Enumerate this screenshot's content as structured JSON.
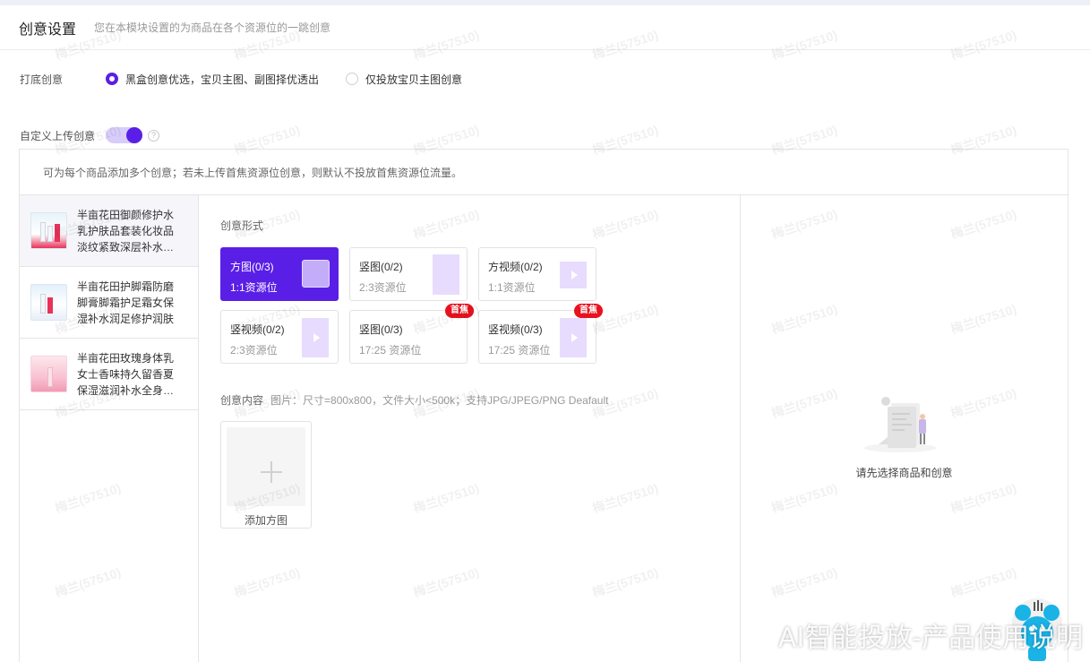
{
  "header": {
    "title": "创意设置",
    "desc": "您在本模块设置的为商品在各个资源位的一跳创意"
  },
  "fallback": {
    "label": "打底创意",
    "options": [
      {
        "label": "黑盒创意优选，宝贝主图、副图择优透出",
        "selected": true
      },
      {
        "label": "仅投放宝贝主图创意",
        "selected": false
      }
    ]
  },
  "custom_upload": {
    "label": "自定义上传创意",
    "enabled": true,
    "help": "?"
  },
  "notice": "可为每个商品添加多个创意；若未上传首焦资源位创意，则默认不投放首焦资源位流量。",
  "products": [
    {
      "name": "半亩花田御颜修护水乳护肤品套装化妆品淡纹紧致深层补水保湿"
    },
    {
      "name": "半亩花田护脚霜防磨脚膏脚霜护足霜女保湿补水润足修护润肤"
    },
    {
      "name": "半亩花田玫瑰身体乳女士香味持久留香夏保湿滋润补水全身润肤"
    }
  ],
  "format_section": {
    "label": "创意形式",
    "formats": [
      {
        "name": "方图(0/3)",
        "sub": "1:1资源位",
        "badge": ""
      },
      {
        "name": "竖图(0/2)",
        "sub": "2:3资源位",
        "badge": ""
      },
      {
        "name": "方视频(0/2)",
        "sub": "1:1资源位",
        "badge": ""
      },
      {
        "name": "竖视频(0/2)",
        "sub": "2:3资源位",
        "badge": ""
      },
      {
        "name": "竖图(0/3)",
        "sub": "17:25 资源位",
        "badge": "首焦"
      },
      {
        "name": "竖视频(0/3)",
        "sub": "17:25 资源位",
        "badge": "首焦"
      }
    ]
  },
  "content_section": {
    "label": "创意内容",
    "hint": "图片：尺寸=800x800，文件大小<500k；支持JPG/JPEG/PNG Deafault",
    "add_label": "添加方图",
    "plus": "+"
  },
  "empty_state": {
    "text": "请先选择商品和创意"
  },
  "watermark": "梅兰(57510)",
  "brand_overlay": "AI智能投放-产品使用说明",
  "colors": {
    "accent": "#5a1fe6",
    "accent_light": "#d8ccfb",
    "badge_red": "#e8111d"
  }
}
